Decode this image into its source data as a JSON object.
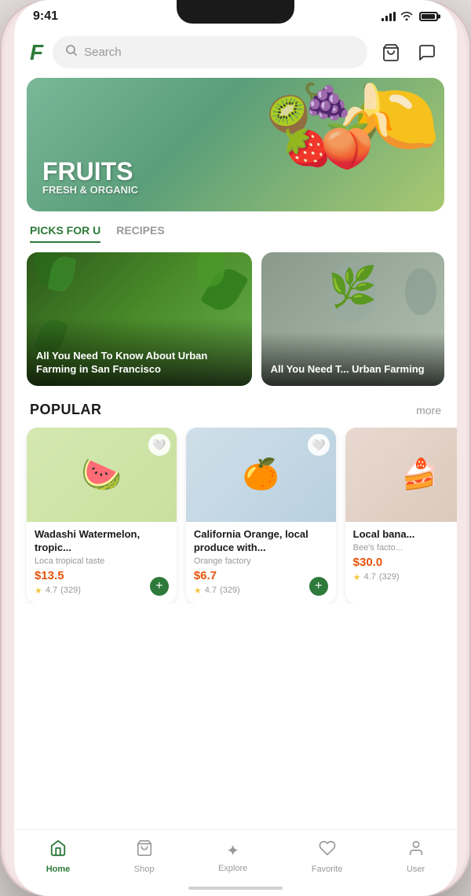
{
  "statusBar": {
    "time": "9:41",
    "icons": [
      "signal",
      "wifi",
      "battery"
    ]
  },
  "header": {
    "logo": "F",
    "search": {
      "placeholder": "Search",
      "value": ""
    },
    "cartLabel": "cart",
    "messageLabel": "message"
  },
  "banner": {
    "title": "FRUITS",
    "subtitle": "FRESH & ORGANIC",
    "alt": "Fresh fruits banner"
  },
  "tabs": [
    {
      "id": "picks",
      "label": "PICKS FOR U",
      "active": true
    },
    {
      "id": "recipes",
      "label": "RECIPES",
      "active": false
    }
  ],
  "articles": [
    {
      "id": 1,
      "title": "All You Need To Know About Urban Farming in San Francisco",
      "bgClass": "farming"
    },
    {
      "id": 2,
      "title": "All You Need Urban Farming",
      "bgClass": "urban"
    }
  ],
  "popular": {
    "sectionTitle": "POPULAR",
    "moreLabel": "more",
    "products": [
      {
        "id": 1,
        "name": "Wadashi Watermelon, tropic...",
        "source": "Loca tropical taste",
        "price": "$13.5",
        "rating": "4.7",
        "ratingCount": "(329)",
        "emoji": "🍉",
        "liked": false
      },
      {
        "id": 2,
        "name": "California Orange, local produce with...",
        "source": "Orange factory",
        "price": "$6.7",
        "rating": "4.7",
        "ratingCount": "(329)",
        "emoji": "🍊",
        "liked": false
      },
      {
        "id": 3,
        "name": "Local bana...",
        "source": "Bee's facto...",
        "price": "$30.0",
        "rating": "4.7",
        "ratingCount": "(329)",
        "emoji": "🍰",
        "liked": false
      }
    ]
  },
  "bottomNav": [
    {
      "id": "home",
      "label": "Home",
      "icon": "🏠",
      "active": true
    },
    {
      "id": "shop",
      "label": "Shop",
      "icon": "🛍",
      "active": false
    },
    {
      "id": "explore",
      "label": "Explore",
      "icon": "✦",
      "active": false
    },
    {
      "id": "favorite",
      "label": "Favorite",
      "icon": "♡",
      "active": false
    },
    {
      "id": "user",
      "label": "User",
      "icon": "👤",
      "active": false
    }
  ]
}
